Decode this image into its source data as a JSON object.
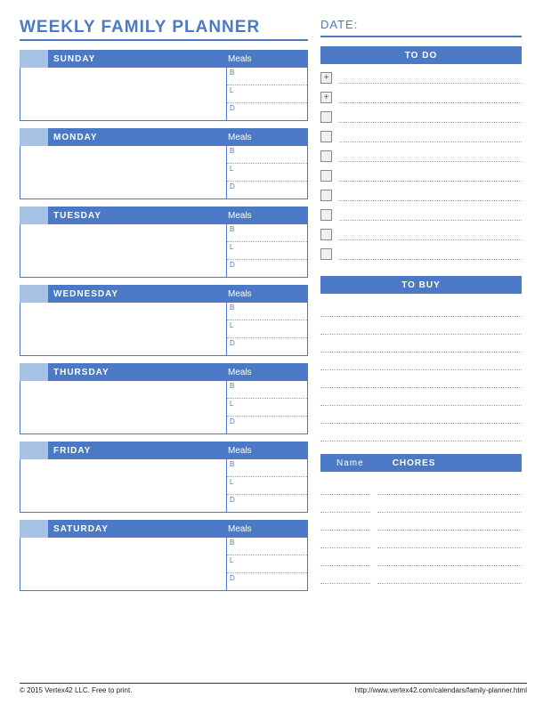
{
  "title": "WEEKLY FAMILY PLANNER",
  "date_label": "DATE:",
  "meals_label": "Meals",
  "meal_codes": {
    "b": "B",
    "l": "L",
    "d": "D"
  },
  "days": [
    {
      "name": "SUNDAY"
    },
    {
      "name": "MONDAY"
    },
    {
      "name": "TUESDAY"
    },
    {
      "name": "WEDNESDAY"
    },
    {
      "name": "THURSDAY"
    },
    {
      "name": "FRIDAY"
    },
    {
      "name": "SATURDAY"
    }
  ],
  "sections": {
    "todo": "TO DO",
    "tobuy": "TO BUY",
    "chores": "CHORES",
    "chores_name_col": "Name"
  },
  "todo_items": [
    {
      "mark": "+"
    },
    {
      "mark": "+"
    },
    {
      "mark": ""
    },
    {
      "mark": ""
    },
    {
      "mark": ""
    },
    {
      "mark": ""
    },
    {
      "mark": ""
    },
    {
      "mark": ""
    },
    {
      "mark": ""
    },
    {
      "mark": ""
    }
  ],
  "tobuy_lines": 8,
  "chores_rows": 6,
  "footer": {
    "copyright": "© 2015 Vertex42 LLC. Free to print.",
    "url": "http://www.vertex42.com/calendars/family-planner.html"
  }
}
